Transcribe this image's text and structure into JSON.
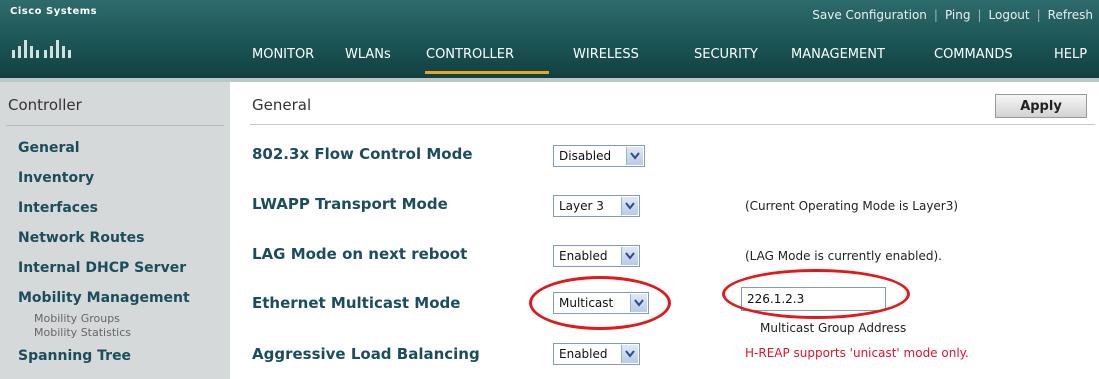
{
  "header": {
    "brand": "Cisco Systems",
    "links": [
      "Save Configuration",
      "Ping",
      "Logout",
      "Refresh"
    ],
    "tabs": [
      {
        "label": "MONITOR"
      },
      {
        "label": "WLANs"
      },
      {
        "label": "CONTROLLER",
        "active": true
      },
      {
        "label": "WIRELESS"
      },
      {
        "label": "SECURITY"
      },
      {
        "label": "MANAGEMENT"
      },
      {
        "label": "COMMANDS"
      },
      {
        "label": "HELP"
      }
    ],
    "accent_color": "#f0a31e",
    "bar_color": "#1c5556"
  },
  "sidebar": {
    "title": "Controller",
    "items": [
      {
        "label": "General"
      },
      {
        "label": "Inventory"
      },
      {
        "label": "Interfaces"
      },
      {
        "label": "Network Routes"
      },
      {
        "label": "Internal DHCP Server"
      },
      {
        "label": "Mobility Management"
      },
      {
        "label": "Spanning Tree"
      }
    ],
    "subitems": [
      {
        "label": "Mobility Groups"
      },
      {
        "label": "Mobility Statistics"
      }
    ]
  },
  "main": {
    "title": "General",
    "apply_label": "Apply",
    "fields": [
      {
        "label": "802.3x Flow Control Mode",
        "value": "Disabled",
        "note": ""
      },
      {
        "label": "LWAPP Transport Mode",
        "value": "Layer 3",
        "note": "(Current Operating Mode is Layer3)"
      },
      {
        "label": "LAG Mode on next reboot",
        "value": "Enabled",
        "note": "(LAG Mode is currently enabled)."
      },
      {
        "label": "Ethernet Multicast Mode",
        "value": "Multicast",
        "note": ""
      },
      {
        "label": "Aggressive Load Balancing",
        "value": "Enabled",
        "note": "H-REAP supports 'unicast' mode only."
      }
    ],
    "multicast_group_address": "226.1.2.3",
    "multicast_group_caption": "Multicast Group Address",
    "highlight_color": "#e01a1a"
  }
}
